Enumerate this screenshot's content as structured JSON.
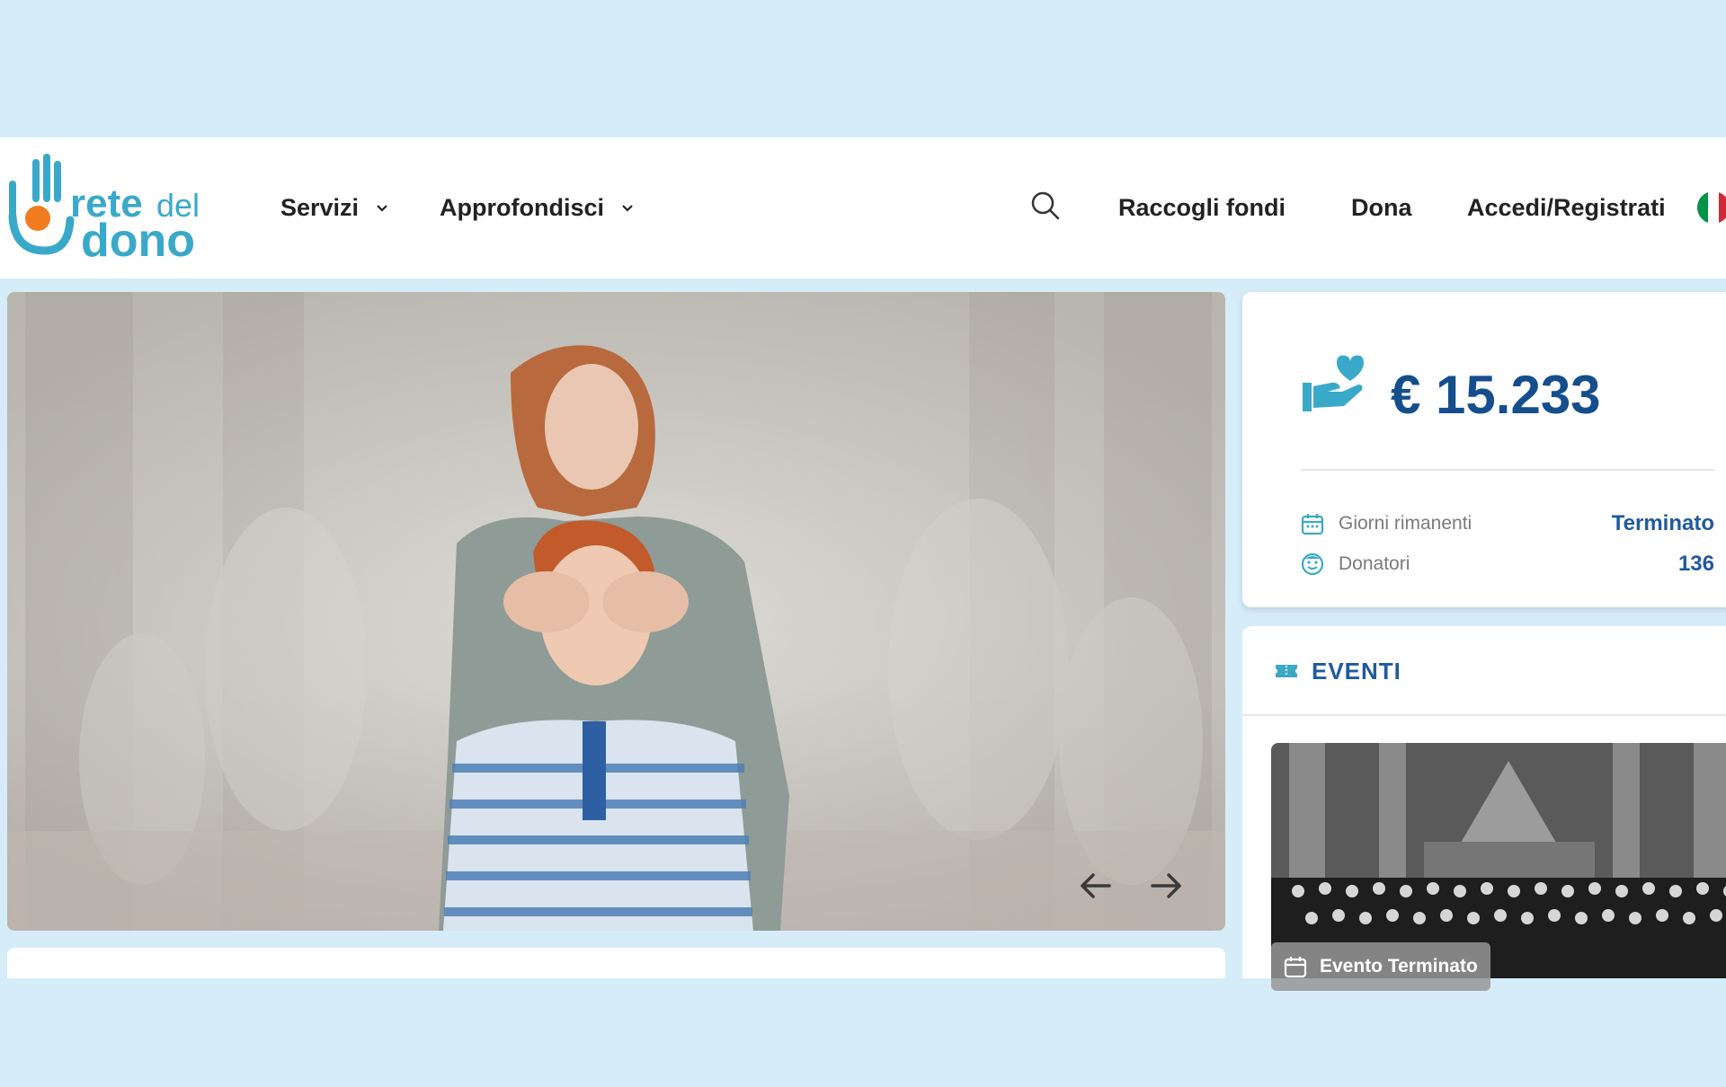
{
  "header": {
    "nav": {
      "servizi": "Servizi",
      "approfondisci": "Approfondisci",
      "raccogli_fondi": "Raccogli fondi",
      "dona": "Dona",
      "accedi": "Accedi/Registrati"
    },
    "logo_text": "retedeldono",
    "language_flag": {
      "icon": "italian-flag-icon",
      "colors": [
        "#009246",
        "#ffffff",
        "#ce2b37"
      ]
    }
  },
  "hero": {
    "icons": {
      "prev": "arrow-left-icon",
      "next": "arrow-right-icon"
    }
  },
  "funds": {
    "amount": "€ 15.233",
    "icon": "donation-hand-heart-icon",
    "stats": [
      {
        "label": "Giorni rimanenti",
        "value": "Terminato",
        "icon": "calendar-icon"
      },
      {
        "label": "Donatori",
        "value": "136",
        "icon": "smiley-icon"
      }
    ]
  },
  "events": {
    "title": "EVENTI",
    "icon": "ticket-icon",
    "item": {
      "badge": "Evento Terminato",
      "badge_icon": "calendar-icon"
    }
  },
  "colors": {
    "background": "#d6edf9",
    "brand_teal": "#3aa9c9",
    "brand_orange": "#f07c1e",
    "primary_blue": "#144e8c",
    "link_blue": "#1f5aa0"
  }
}
